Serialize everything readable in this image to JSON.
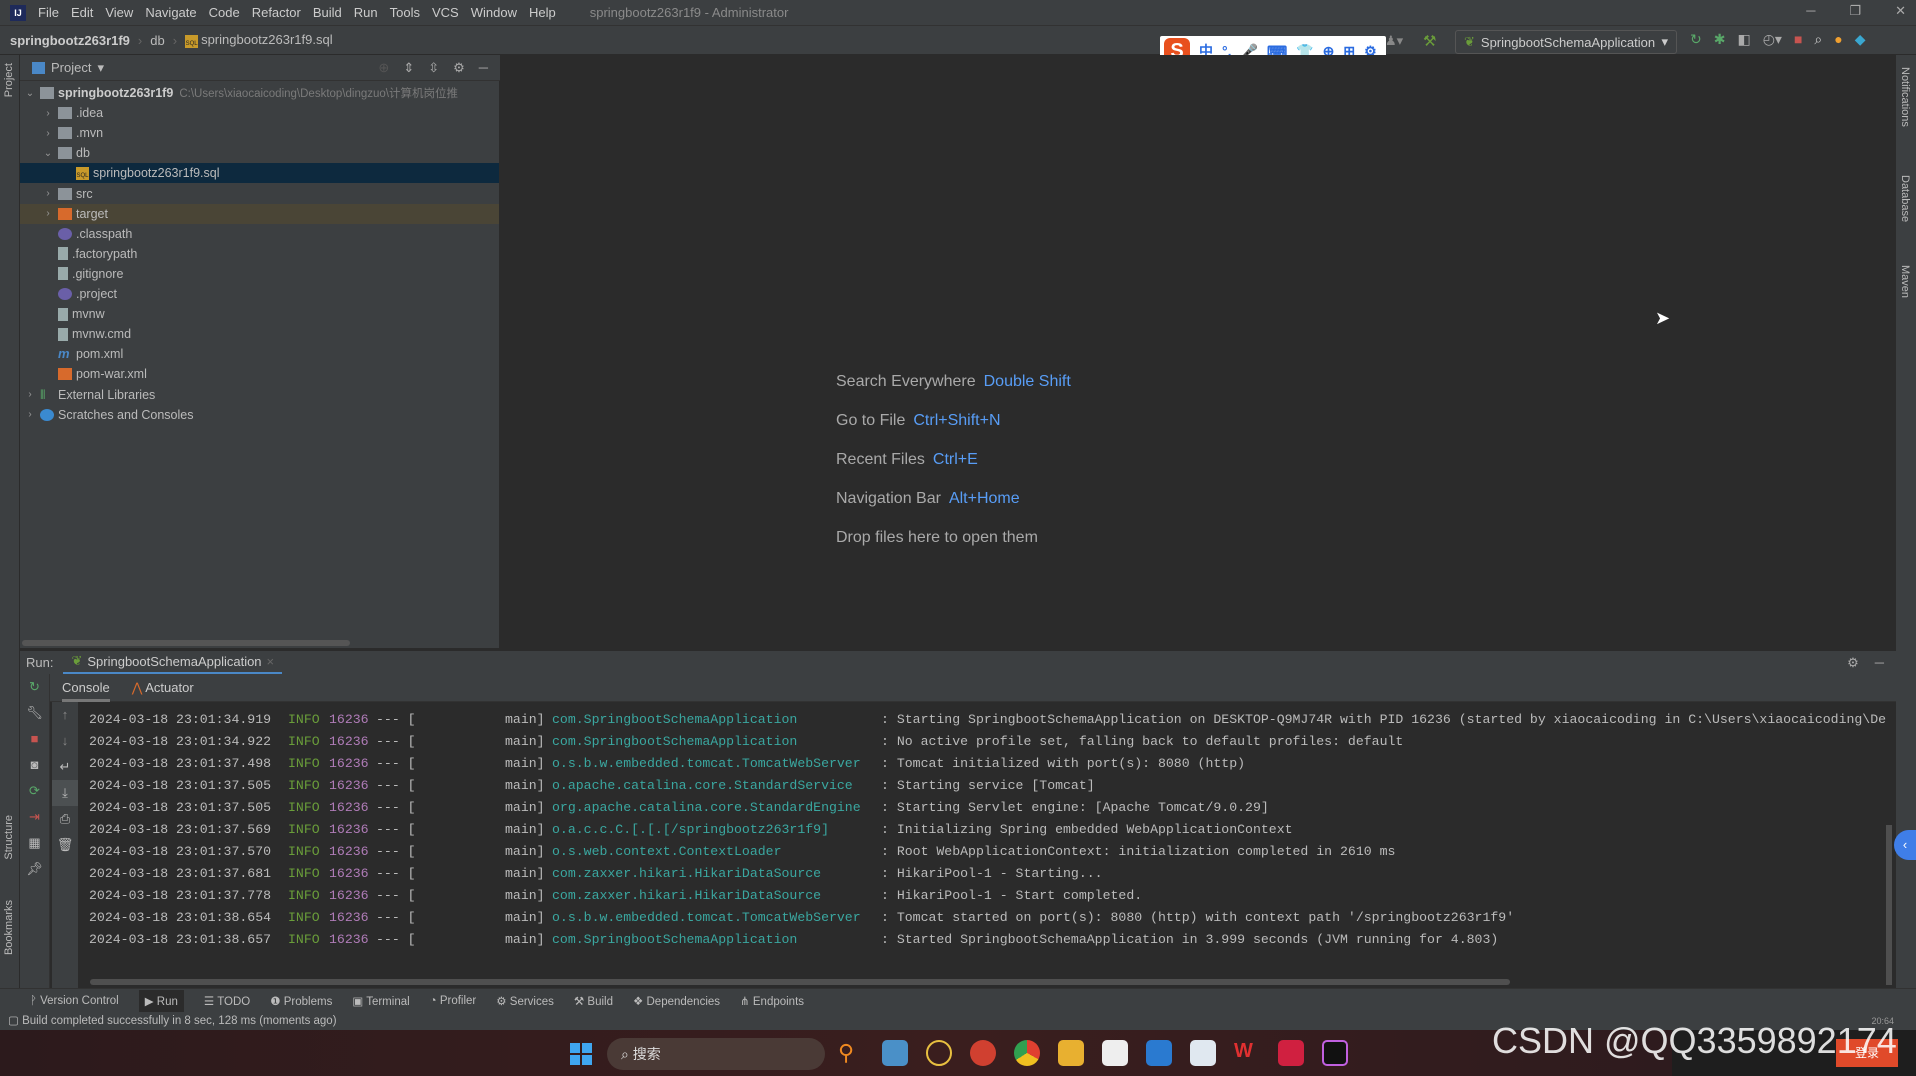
{
  "menubar": {
    "logo": "IJ",
    "items": [
      "File",
      "Edit",
      "View",
      "Navigate",
      "Code",
      "Refactor",
      "Build",
      "Run",
      "Tools",
      "VCS",
      "Window",
      "Help"
    ],
    "title": "springbootz263r1f9 - Administrator"
  },
  "breadcrumb": {
    "project": "springbootz263r1f9",
    "folder": "db",
    "file": "springbootz263r1f9.sql",
    "sql_badge": "SQL"
  },
  "ime": {
    "logo": "S",
    "items": [
      "中",
      "°,",
      "🎤",
      "⌨",
      "👕",
      "⊕",
      "⊞",
      "⚙"
    ]
  },
  "run_config": {
    "label": "SpringbootSchemaApplication"
  },
  "left_strip": {
    "project": "Project",
    "structure": "Structure",
    "bookmarks": "Bookmarks"
  },
  "right_strip": {
    "notifications": "Notifications",
    "database": "Database",
    "maven": "Maven"
  },
  "project_panel": {
    "title": "Project",
    "tree": [
      {
        "label": "springbootz263r1f9",
        "path": "C:\\Users\\xiaocaicoding\\Desktop\\dingzuo\\计算机岗位推",
        "depth": 0,
        "arrow": "down",
        "icon": "module",
        "bold": true
      },
      {
        "label": ".idea",
        "depth": 1,
        "arrow": "right",
        "icon": "folder"
      },
      {
        "label": ".mvn",
        "depth": 1,
        "arrow": "right",
        "icon": "folder"
      },
      {
        "label": "db",
        "depth": 1,
        "arrow": "down",
        "icon": "folder"
      },
      {
        "label": "springbootz263r1f9.sql",
        "depth": 2,
        "icon": "sql",
        "selected": true
      },
      {
        "label": "src",
        "depth": 1,
        "arrow": "right",
        "icon": "folder"
      },
      {
        "label": "target",
        "depth": 1,
        "arrow": "right",
        "icon": "folder-orange",
        "highlight": true
      },
      {
        "label": ".classpath",
        "depth": 1,
        "icon": "eclipse"
      },
      {
        "label": ".factorypath",
        "depth": 1,
        "icon": "file"
      },
      {
        "label": ".gitignore",
        "depth": 1,
        "icon": "file"
      },
      {
        "label": ".project",
        "depth": 1,
        "icon": "eclipse"
      },
      {
        "label": "mvnw",
        "depth": 1,
        "icon": "file"
      },
      {
        "label": "mvnw.cmd",
        "depth": 1,
        "icon": "file"
      },
      {
        "label": "pom.xml",
        "depth": 1,
        "icon": "maven"
      },
      {
        "label": "pom-war.xml",
        "depth": 1,
        "icon": "xml"
      },
      {
        "label": "External Libraries",
        "depth": 0,
        "arrow": "right",
        "icon": "library"
      },
      {
        "label": "Scratches and Consoles",
        "depth": 0,
        "arrow": "right",
        "icon": "scratches"
      }
    ]
  },
  "editor_hints": [
    {
      "label": "Search Everywhere",
      "key": "Double Shift"
    },
    {
      "label": "Go to File",
      "key": "Ctrl+Shift+N"
    },
    {
      "label": "Recent Files",
      "key": "Ctrl+E"
    },
    {
      "label": "Navigation Bar",
      "key": "Alt+Home"
    },
    {
      "label": "Drop files here to open them",
      "key": ""
    }
  ],
  "run_panel": {
    "label": "Run:",
    "tab": "SpringbootSchemaApplication",
    "console_tab": "Console",
    "actuator_tab": "Actuator"
  },
  "log_lines": [
    {
      "ts": "2024-03-18 23:01:34.919",
      "level": "INFO",
      "pid": "16236",
      "thread": "main]",
      "logger": "com.SpringbootSchemaApplication",
      "msg": ": Starting SpringbootSchemaApplication on DESKTOP-Q9MJ74R with PID 16236 (started by xiaocaicoding in C:\\Users\\xiaocaicoding\\De"
    },
    {
      "ts": "2024-03-18 23:01:34.922",
      "level": "INFO",
      "pid": "16236",
      "thread": "main]",
      "logger": "com.SpringbootSchemaApplication",
      "msg": ": No active profile set, falling back to default profiles: default"
    },
    {
      "ts": "2024-03-18 23:01:37.498",
      "level": "INFO",
      "pid": "16236",
      "thread": "main]",
      "logger": "o.s.b.w.embedded.tomcat.TomcatWebServer",
      "msg": ": Tomcat initialized with port(s): 8080 (http)"
    },
    {
      "ts": "2024-03-18 23:01:37.505",
      "level": "INFO",
      "pid": "16236",
      "thread": "main]",
      "logger": "o.apache.catalina.core.StandardService",
      "msg": ": Starting service [Tomcat]"
    },
    {
      "ts": "2024-03-18 23:01:37.505",
      "level": "INFO",
      "pid": "16236",
      "thread": "main]",
      "logger": "org.apache.catalina.core.StandardEngine",
      "msg": ": Starting Servlet engine: [Apache Tomcat/9.0.29]"
    },
    {
      "ts": "2024-03-18 23:01:37.569",
      "level": "INFO",
      "pid": "16236",
      "thread": "main]",
      "logger": "o.a.c.c.C.[.[.[/springbootz263r1f9]",
      "msg": ": Initializing Spring embedded WebApplicationContext"
    },
    {
      "ts": "2024-03-18 23:01:37.570",
      "level": "INFO",
      "pid": "16236",
      "thread": "main]",
      "logger": "o.s.web.context.ContextLoader",
      "msg": ": Root WebApplicationContext: initialization completed in 2610 ms"
    },
    {
      "ts": "2024-03-18 23:01:37.681",
      "level": "INFO",
      "pid": "16236",
      "thread": "main]",
      "logger": "com.zaxxer.hikari.HikariDataSource",
      "msg": ": HikariPool-1 - Starting..."
    },
    {
      "ts": "2024-03-18 23:01:37.778",
      "level": "INFO",
      "pid": "16236",
      "thread": "main]",
      "logger": "com.zaxxer.hikari.HikariDataSource",
      "msg": ": HikariPool-1 - Start completed."
    },
    {
      "ts": "2024-03-18 23:01:38.654",
      "level": "INFO",
      "pid": "16236",
      "thread": "main]",
      "logger": "o.s.b.w.embedded.tomcat.TomcatWebServer",
      "msg": ": Tomcat started on port(s): 8080 (http) with context path '/springbootz263r1f9'"
    },
    {
      "ts": "2024-03-18 23:01:38.657",
      "level": "INFO",
      "pid": "16236",
      "thread": "main]",
      "logger": "com.SpringbootSchemaApplication",
      "msg": ": Started SpringbootSchemaApplication in 3.999 seconds (JVM running for 4.803)"
    }
  ],
  "tool_windows": [
    "Version Control",
    "Run",
    "TODO",
    "Problems",
    "Terminal",
    "Profiler",
    "Services",
    "Build",
    "Dependencies",
    "Endpoints"
  ],
  "tool_icons": [
    "ᚹ",
    "▶",
    "☰",
    "❶",
    "▣",
    "◔",
    "⚙",
    "⚒",
    "❖",
    "⋔"
  ],
  "status": {
    "message": "Build completed successfully in 8 sec, 128 ms (moments ago)",
    "time": "20:64"
  },
  "taskbar": {
    "search": "搜索",
    "tray_button": "登录"
  },
  "watermark": "CSDN @QQ3359892174",
  "colors": {
    "accent": "#589df6",
    "info": "#6a9d3a",
    "pid": "#b07cb8",
    "logger": "#3aa7a0"
  }
}
